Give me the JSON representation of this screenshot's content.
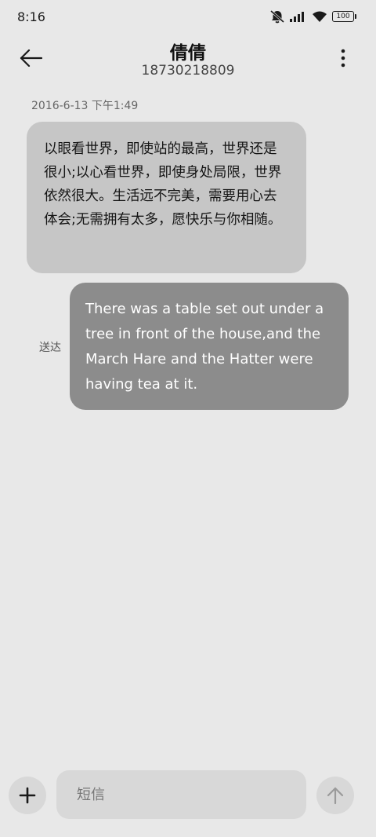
{
  "status_bar": {
    "time": "8:16",
    "battery": "100",
    "icons": [
      "mute-alarm-icon",
      "signal-icon",
      "wifi-icon",
      "battery-icon"
    ]
  },
  "header": {
    "contact_name": "倩倩",
    "contact_number": "18730218809",
    "icons": [
      "back-arrow-icon",
      "more-vertical-icon"
    ]
  },
  "conversation": {
    "timestamp": "2016-6-13 下午1:49",
    "messages": [
      {
        "direction": "incoming",
        "text": "以眼看世界，即使站的最高，世界还是很小;以心看世界，即使身处局限，世界依然很大。生活远不完美，需要用心去体会;无需拥有太多，愿快乐与你相随。"
      },
      {
        "direction": "outgoing",
        "text": "There was a table set out under a tree in front of the house,and the March Hare and the Hatter were having tea at it.",
        "status": "送达"
      }
    ]
  },
  "compose": {
    "placeholder": "短信",
    "value": "",
    "icons": [
      "plus-icon",
      "send-arrow-up-icon"
    ]
  },
  "colors": {
    "background": "#e8e8e8",
    "incoming_bubble": "#c6c6c6",
    "outgoing_bubble": "#8c8c8c",
    "compose_field": "#d8d8d8"
  }
}
